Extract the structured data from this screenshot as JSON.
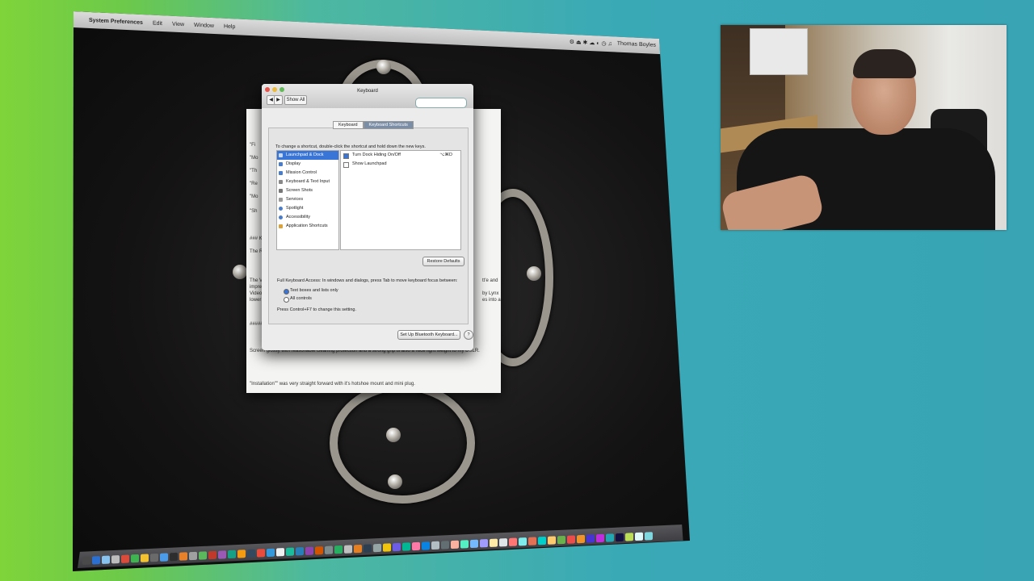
{
  "menubar": {
    "app_name": "System Preferences",
    "menus": [
      "Edit",
      "View",
      "Window",
      "Help"
    ],
    "user": "Thomas Boyles"
  },
  "document_bg": {
    "bullets": [
      "\"Fi",
      "\"Mo",
      "\"Th",
      "\"Re",
      "\"Mo",
      "\"Sh"
    ],
    "lines": [
      "### Keyb",
      "The R3",
      "The Ve",
      "impress",
      "Videosk",
      "lower",
      "##### F"
    ],
    "right_frags": [
      "tt'e and",
      "by Lynx",
      "es into a"
    ],
    "line_extra": "Screen glossy with reasonable cleaning protection and a strong grip is also a Nice light weight to my DSLR.",
    "installation": "\"Installation\"\" was very straight forward with it's hotshoe mount and mini plug."
  },
  "keyboard_window": {
    "title": "Keyboard",
    "show_all": "Show All",
    "search_placeholder": "",
    "tabs": [
      "Keyboard",
      "Keyboard Shortcuts"
    ],
    "hint": "To change a shortcut, double-click the shortcut and hold down the new keys.",
    "categories": [
      "Launchpad & Dock",
      "Display",
      "Mission Control",
      "Keyboard & Text Input",
      "Screen Shots",
      "Services",
      "Spotlight",
      "Accessibility",
      "Application Shortcuts"
    ],
    "shortcuts": [
      {
        "label": "Turn Dock Hiding On/Off",
        "key": "⌥⌘D",
        "checked": true
      },
      {
        "label": "Show Launchpad",
        "key": "",
        "checked": false
      }
    ],
    "restore_defaults": "Restore Defaults",
    "full_access_label": "Full Keyboard Access: In windows and dialogs, press Tab to move keyboard focus between:",
    "radio_options": [
      {
        "label": "Text boxes and lists only",
        "selected": true
      },
      {
        "label": "All controls",
        "selected": false
      }
    ],
    "ctrl_f7_note": "Press Control+F7 to change this setting.",
    "bluetooth_button": "Set Up Bluetooth Keyboard...",
    "help_glyph": "?"
  },
  "dock": {
    "icon_colors": [
      "#4a4a4a",
      "#2b6fd1",
      "#88c3f0",
      "#bcbcbc",
      "#d94b3a",
      "#3fb34f",
      "#f2c230",
      "#6a6a6a",
      "#4b9be8",
      "#2d2d2d",
      "#e9812b",
      "#a0a0a0",
      "#5cb85c",
      "#c0392b",
      "#9b59b6",
      "#16a085",
      "#f39c12",
      "#34495e",
      "#e74c3c",
      "#3498db",
      "#ecf0f1",
      "#1abc9c",
      "#2980b9",
      "#8e44ad",
      "#d35400",
      "#7f8c8d",
      "#27ae60",
      "#c0c0c0",
      "#e67e22",
      "#2c3e50",
      "#95a5a6",
      "#f1c40f",
      "#6c5ce7",
      "#00b894",
      "#fd79a8",
      "#0984e3",
      "#b2bec3",
      "#636e72",
      "#fab1a0",
      "#55efc4",
      "#74b9ff",
      "#a29bfe",
      "#ffeaa7",
      "#dfe6e9",
      "#ff7675",
      "#81ecec",
      "#e17055",
      "#00cec9",
      "#fdcb6e",
      "#6ab04c",
      "#eb4d4b",
      "#f0932b",
      "#4834d4",
      "#be2edd",
      "#22a6b3",
      "#130f40",
      "#badc58",
      "#dff9fb",
      "#7ed6df"
    ]
  }
}
